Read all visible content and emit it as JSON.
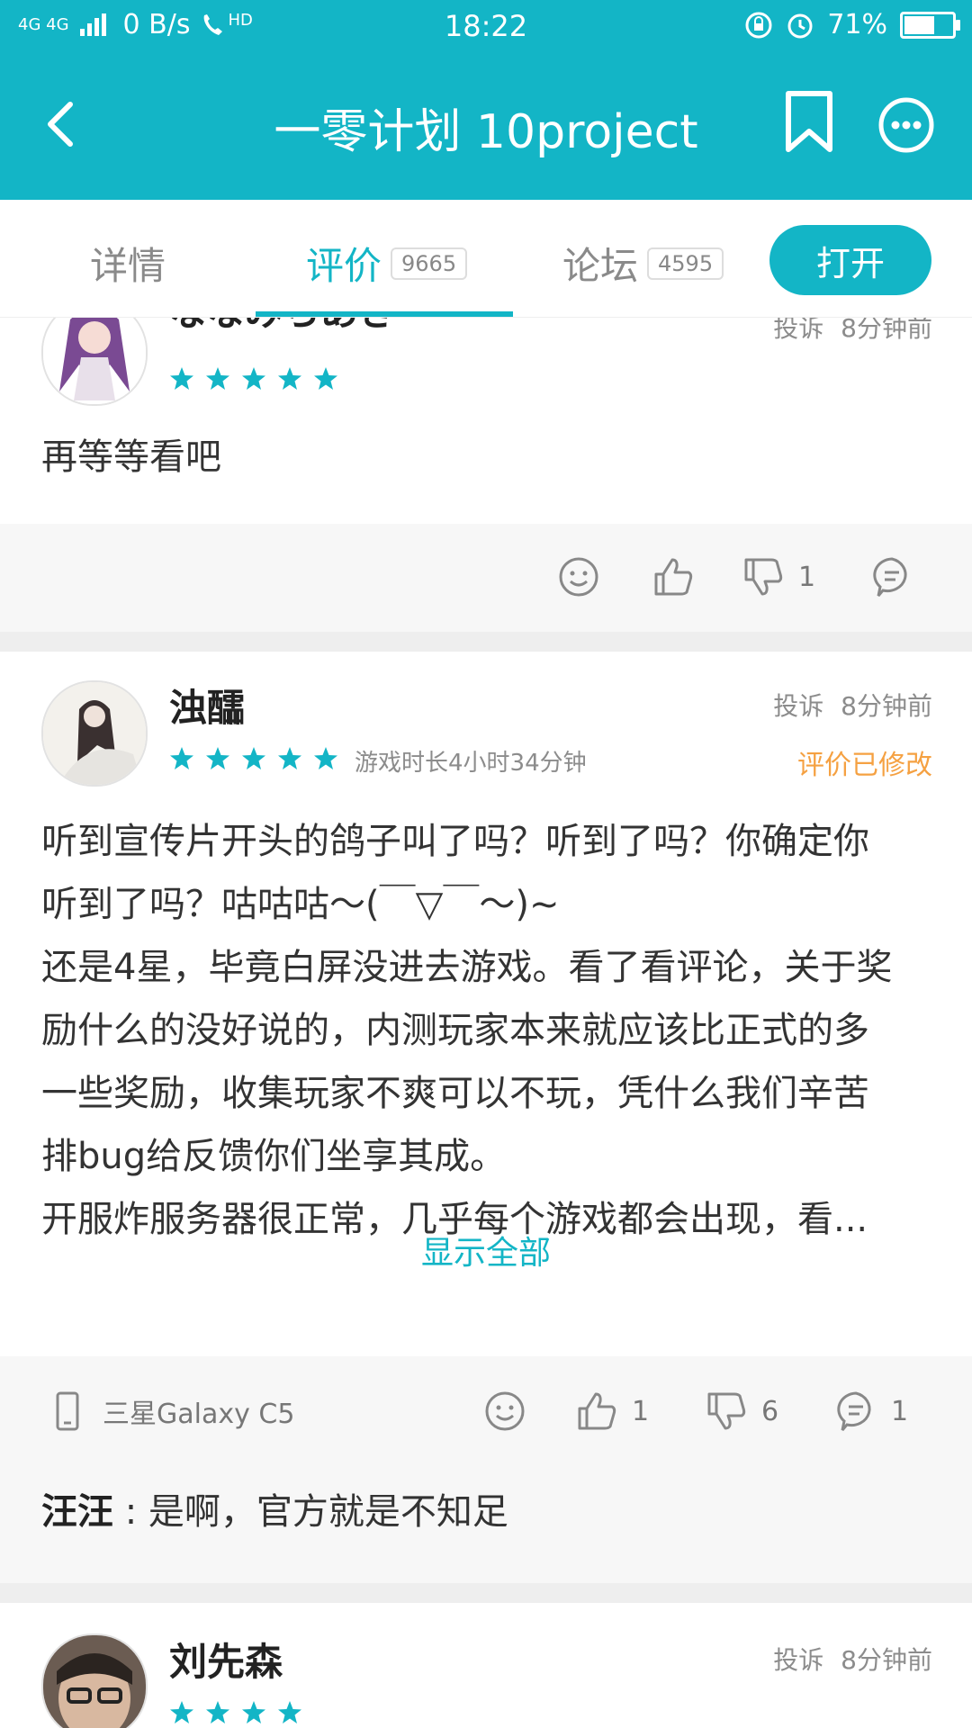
{
  "status_bar": {
    "network": "4G 4G",
    "speed": "0 B/s",
    "hd": "HD",
    "time": "18:22",
    "battery": "71%",
    "battery_level": 0.71
  },
  "app_bar": {
    "title": "一零计划 10project"
  },
  "tabs": [
    {
      "label": "详情",
      "count": ""
    },
    {
      "label": "评价",
      "count": "9665"
    },
    {
      "label": "论坛",
      "count": "4595"
    }
  ],
  "open_button": "打开",
  "reviews": [
    {
      "user": "ななみちあき",
      "report": "投诉",
      "time": "8分钟前",
      "stars": 5,
      "text": "再等等看吧",
      "dislike_count": "1"
    },
    {
      "user": "浊醽",
      "report": "投诉",
      "time": "8分钟前",
      "stars": 5,
      "playtime": "游戏时长4小时34分钟",
      "modified": "评价已修改",
      "text_lines": [
        "听到宣传片开头的鸽子叫了吗？听到了吗？你确定你",
        "听到了吗？咕咕咕～(￣▽￣～)~",
        "还是4星，毕竟白屏没进去游戏。看了看评论，关于奖",
        "励什么的没好说的，内测玩家本来就应该比正式的多",
        "一些奖励，收集玩家不爽可以不玩，凭什么我们辛苦",
        "排bug给反馈你们坐享其成。",
        "开服炸服务器很正常，几乎每个游戏都会出现，看..."
      ],
      "show_all": "显示全部",
      "device": "三星Galaxy C5",
      "like_count": "1",
      "dislike_count": "6",
      "reply_count": "1",
      "reply": {
        "user": "汪汪",
        "sep": " : ",
        "text": "是啊，官方就是不知足"
      }
    },
    {
      "user": "刘先森",
      "report": "投诉",
      "time": "8分钟前",
      "stars": 4
    }
  ],
  "colors": {
    "accent": "#13b5c6",
    "modified": "#f5a142"
  }
}
